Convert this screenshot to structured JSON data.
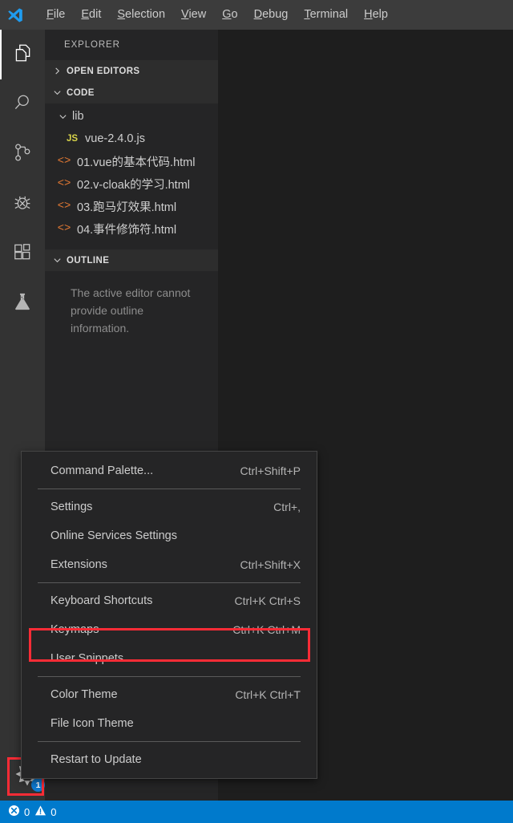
{
  "menubar": {
    "logo_icon": "vscode-logo-icon",
    "items": [
      {
        "label": "File",
        "mnemonic": "F"
      },
      {
        "label": "Edit",
        "mnemonic": "E"
      },
      {
        "label": "Selection",
        "mnemonic": "S"
      },
      {
        "label": "View",
        "mnemonic": "V"
      },
      {
        "label": "Go",
        "mnemonic": "G"
      },
      {
        "label": "Debug",
        "mnemonic": "D"
      },
      {
        "label": "Terminal",
        "mnemonic": "T"
      },
      {
        "label": "Help",
        "mnemonic": "H"
      }
    ]
  },
  "activitybar": {
    "items": [
      {
        "name": "explorer",
        "icon": "files-icon",
        "active": true
      },
      {
        "name": "search",
        "icon": "search-icon",
        "active": false
      },
      {
        "name": "source-control",
        "icon": "source-control-icon",
        "active": false
      },
      {
        "name": "debug",
        "icon": "debug-bug-icon",
        "active": false
      },
      {
        "name": "extensions",
        "icon": "extensions-icon",
        "active": false
      },
      {
        "name": "testing",
        "icon": "beaker-flask-icon",
        "active": false
      }
    ],
    "manage": {
      "icon": "gear-icon",
      "badge": "1"
    }
  },
  "sidebar": {
    "title": "EXPLORER",
    "sections": [
      {
        "label": "OPEN EDITORS",
        "expanded": false
      },
      {
        "label": "CODE",
        "expanded": true
      }
    ],
    "tree": [
      {
        "label": "lib",
        "type": "folder",
        "indent": 1,
        "expanded": true
      },
      {
        "label": "vue-2.4.0.js",
        "type": "js",
        "indent": 2,
        "icon_text": "JS"
      },
      {
        "label": "01.vue的基本代码.html",
        "type": "html",
        "indent": 1,
        "icon_text": "<>"
      },
      {
        "label": "02.v-cloak的学习.html",
        "type": "html",
        "indent": 1,
        "icon_text": "<>"
      },
      {
        "label": "03.跑马灯效果.html",
        "type": "html",
        "indent": 1,
        "icon_text": "<>"
      },
      {
        "label": "04.事件修饰符.html",
        "type": "html",
        "indent": 1,
        "icon_text": "<>"
      }
    ],
    "outline": {
      "label": "OUTLINE",
      "expanded": true,
      "message": "The active editor cannot provide outline information."
    }
  },
  "context_menu": {
    "entries": [
      {
        "kind": "item",
        "label": "Command Palette...",
        "shortcut": "Ctrl+Shift+P",
        "highlighted": false
      },
      {
        "kind": "separator"
      },
      {
        "kind": "item",
        "label": "Settings",
        "shortcut": "Ctrl+,",
        "highlighted": false
      },
      {
        "kind": "item",
        "label": "Online Services Settings",
        "shortcut": "",
        "highlighted": false
      },
      {
        "kind": "item",
        "label": "Extensions",
        "shortcut": "Ctrl+Shift+X",
        "highlighted": false
      },
      {
        "kind": "separator"
      },
      {
        "kind": "item",
        "label": "Keyboard Shortcuts",
        "shortcut": "Ctrl+K Ctrl+S",
        "highlighted": false
      },
      {
        "kind": "item",
        "label": "Keymaps",
        "shortcut": "Ctrl+K Ctrl+M",
        "highlighted": false
      },
      {
        "kind": "item",
        "label": "User Snippets",
        "shortcut": "",
        "highlighted": true
      },
      {
        "kind": "separator"
      },
      {
        "kind": "item",
        "label": "Color Theme",
        "shortcut": "Ctrl+K Ctrl+T",
        "highlighted": false
      },
      {
        "kind": "item",
        "label": "File Icon Theme",
        "shortcut": "",
        "highlighted": false
      },
      {
        "kind": "separator"
      },
      {
        "kind": "item",
        "label": "Restart to Update",
        "shortcut": "",
        "highlighted": false
      }
    ]
  },
  "statusbar": {
    "errors": {
      "icon": "error-circle-icon",
      "count": "0"
    },
    "warnings": {
      "icon": "warning-triangle-icon",
      "count": "0"
    }
  },
  "colors": {
    "annotation": "#fb2c36",
    "accent": "#007acc",
    "badge": "#0e7ad1",
    "activity_bar": "#333333",
    "sidebar": "#252526",
    "editor": "#1e1e1e",
    "menubar": "#3c3c3c"
  }
}
